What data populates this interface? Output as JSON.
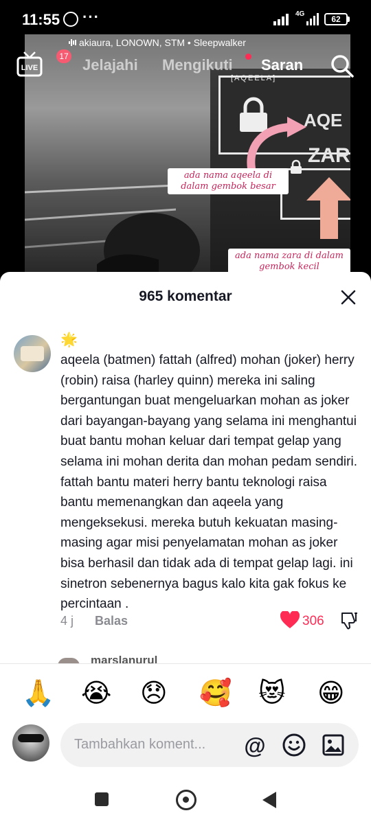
{
  "status_bar": {
    "time": "11:55",
    "dots": "···",
    "network": "4G",
    "battery": "62"
  },
  "video": {
    "music": "akiaura, LONOWN, STM • Sleepwalker",
    "screen_text_top": "[AQEELA]",
    "screen_text_aq": "AQE",
    "screen_text_za": "ZAR",
    "caption_1": "ada nama aqeela di dalam gembok besar",
    "caption_2": "ada nama zara di dalam gembok kecil"
  },
  "top_nav": {
    "notif_count": "17",
    "tabs": [
      {
        "label": "Jelajahi",
        "active": false
      },
      {
        "label": "Mengikuti",
        "active": false
      },
      {
        "label": "Saran",
        "active": true
      }
    ]
  },
  "comments_sheet": {
    "title": "965 komentar",
    "comment": {
      "username": "🌟",
      "text": "aqeela (batmen) fattah (alfred) mohan (joker) herry (robin) raisa (harley quinn) mereka ini saling bergantungan buat mengeluarkan mohan as joker dari bayangan-bayang yang selama ini menghantui buat bantu mohan keluar dari tempat gelap yang selama ini mohan derita dan mohan pedam sendiri. fattah bantu materi herry bantu teknologi raisa bantu memenangkan dan aqeela yang mengeksekusi. mereka butuh kekuatan masing-masing agar misi penyelamatan mohan as joker bisa berhasil dan tidak ada di tempat gelap lagi. ini sinetron sebenernya bagus kalo kita gak fokus ke percintaan .",
      "time": "4 j",
      "reply_label": "Balas",
      "likes": "306"
    },
    "next_comment_username": "marslanurul"
  },
  "input_area": {
    "emojis": [
      "🙏",
      "😭",
      "😞",
      "🥰",
      "😻",
      "😁"
    ],
    "placeholder": "Tambahkan koment...",
    "at_label": "@"
  },
  "colors": {
    "accent": "#fe2c55",
    "caption_text": "#c8245a",
    "sheet_bg": "#ffffff",
    "muted": "#8a8b91"
  }
}
